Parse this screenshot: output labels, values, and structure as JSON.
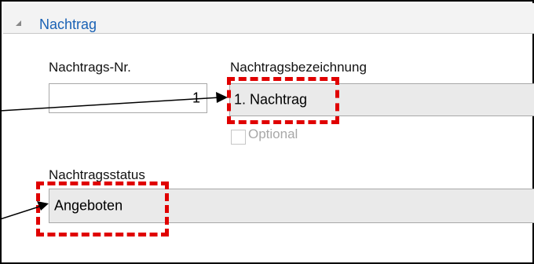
{
  "group": {
    "title": "Nachtrag"
  },
  "fields": {
    "nummer": {
      "label": "Nachtrags-Nr.",
      "value": "1"
    },
    "bezeichnung": {
      "label": "Nachtragsbezeichnung",
      "value": "1. Nachtrag"
    },
    "optional": {
      "label": "Optional",
      "checked": false
    },
    "status": {
      "label": "Nachtragsstatus",
      "value": "Angeboten"
    }
  },
  "colors": {
    "marker": "#e00000",
    "group_title": "#1a62b5",
    "field_bg": "#eaeaea"
  }
}
